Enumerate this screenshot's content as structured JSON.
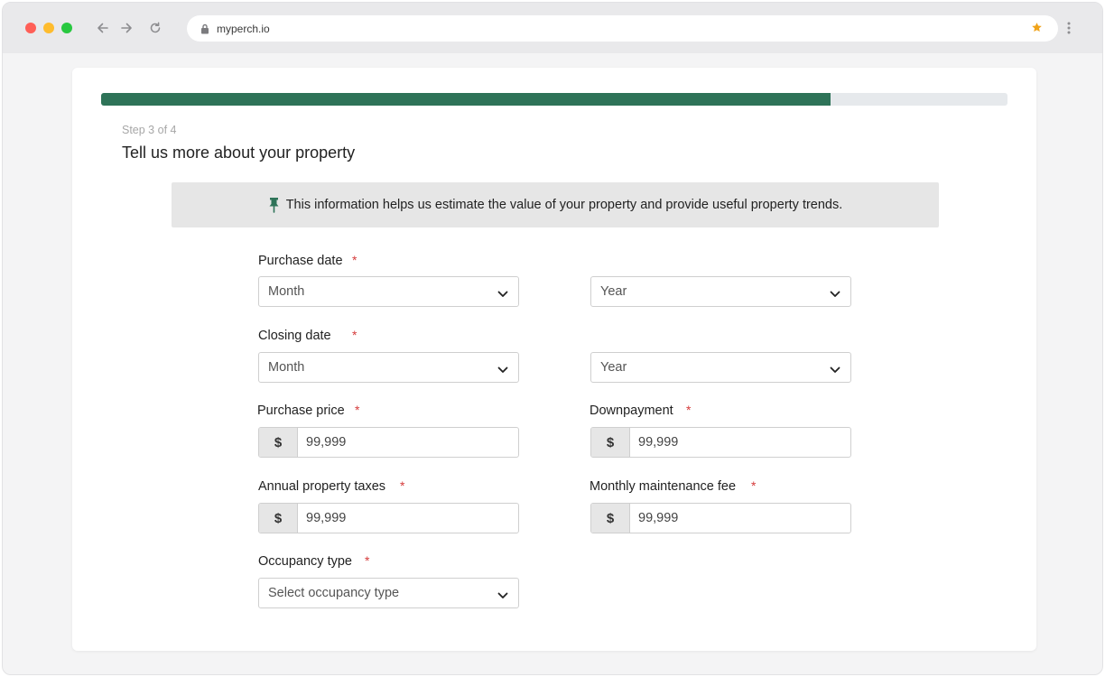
{
  "browser": {
    "url": "myperch.io"
  },
  "progress": {
    "fraction": 0.805
  },
  "form": {
    "step_text": "Step 3 of 4",
    "title": "Tell us more about your property",
    "info_text": "This information helps us estimate the value of your property and provide useful property trends.",
    "required_mark": "*",
    "currency_symbol": "$",
    "purchase_date": {
      "label": "Purchase date",
      "month_value": "Month",
      "year_value": "Year"
    },
    "closing_date": {
      "label": "Closing date",
      "month_value": "Month",
      "year_value": "Year"
    },
    "purchase_price": {
      "label": "Purchase price",
      "value": "99,999"
    },
    "downpayment": {
      "label": "Downpayment",
      "value": "99,999"
    },
    "annual_property_taxes": {
      "label": "Annual property taxes",
      "value": "99,999"
    },
    "monthly_maintenance_fee": {
      "label": "Monthly maintenance fee",
      "value": "99,999"
    },
    "occupancy_type": {
      "label": "Occupancy type",
      "value": "Select occupancy type"
    }
  },
  "colors": {
    "accent": "#2e7358",
    "required": "#d53b3b",
    "star": "#f0a31a"
  }
}
